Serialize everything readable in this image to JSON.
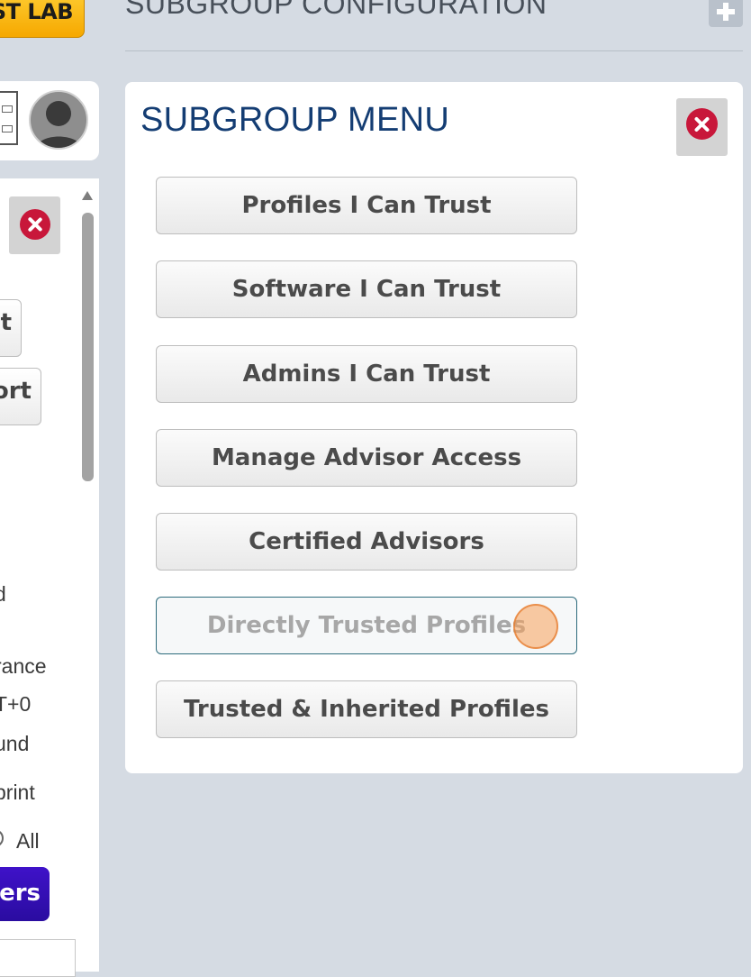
{
  "header": {
    "lab_badge": "ST LAB",
    "title": "SUBGROUP CONFIGURATION",
    "add_icon": "plus-icon"
  },
  "left_panel": {
    "org_icon": "org-chart-icon",
    "avatar_icon": "user-avatar-icon",
    "close_icon": "close-icon",
    "button_fragments": [
      "t",
      "ort"
    ],
    "text_fragments": [
      "d",
      "rance",
      "T+0",
      "und",
      "print",
      "All"
    ],
    "primary_button_fragment": "ers"
  },
  "card": {
    "title": "SUBGROUP MENU",
    "close_icon": "close-icon",
    "menu": [
      {
        "label": "Profiles I Can Trust"
      },
      {
        "label": "Software I Can Trust"
      },
      {
        "label": "Admins I Can Trust"
      },
      {
        "label": "Manage Advisor Access"
      },
      {
        "label": "Certified Advisors"
      },
      {
        "label": "Directly Trusted Profiles",
        "active": true
      },
      {
        "label": "Trusted & Inherited Profiles"
      }
    ]
  },
  "colors": {
    "page_bg": "#d5dbe3",
    "title_blue": "#143d73",
    "close_red": "#c8173a",
    "badge_yellow": "#f6a800",
    "purple": "#3f12c9"
  }
}
